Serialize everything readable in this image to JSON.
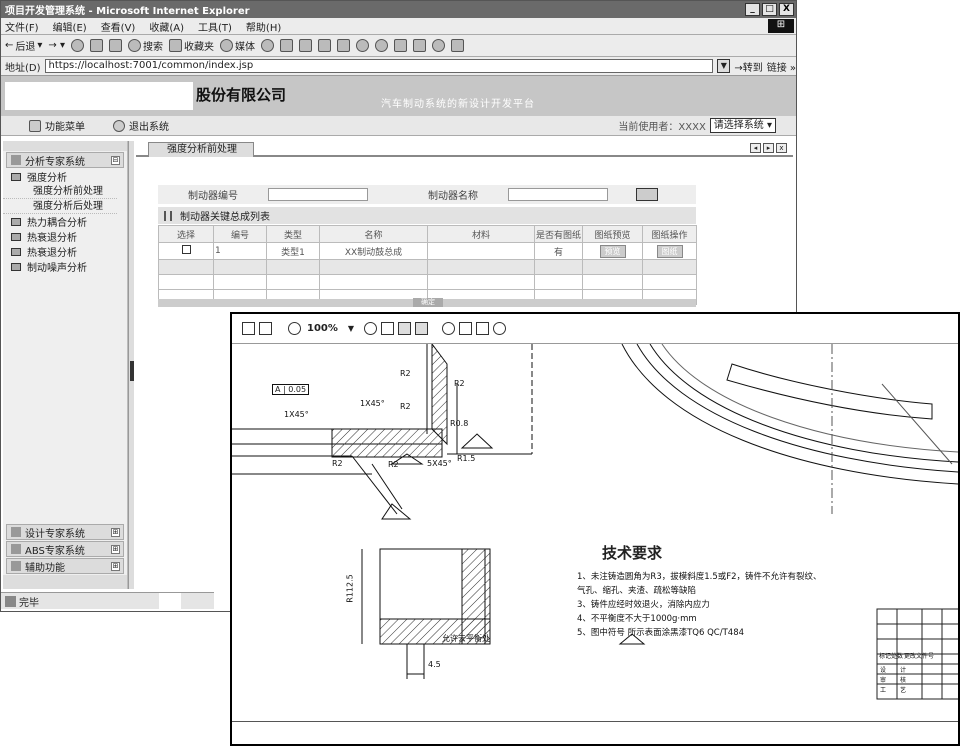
{
  "window": {
    "title": "项目开发管理系统 - Microsoft Internet Explorer",
    "min": "_",
    "max": "□",
    "close": "X"
  },
  "menu": [
    "文件(F)",
    "编辑(E)",
    "查看(V)",
    "收藏(A)",
    "工具(T)",
    "帮助(H)"
  ],
  "toolbar": {
    "back": "后退",
    "search": "搜索",
    "favorites": "收藏夹",
    "media": "媒体"
  },
  "address": {
    "label": "地址(D)",
    "url": "https://localhost:7001/common/index.jsp",
    "go": "转到",
    "links": "链接 »"
  },
  "banner": {
    "company": "股份有限公司",
    "platform": "汽车制动系统的新设计开发平台"
  },
  "nav": {
    "function_menu": "功能菜单",
    "logout": "退出系统",
    "current_user": "当前使用者：XXXX",
    "system_select": "请选择系统"
  },
  "sidebar": {
    "top_section": "分析专家系统",
    "items": [
      {
        "label": "强度分析"
      },
      {
        "label": "强度分析前处理",
        "sub": true
      },
      {
        "label": "强度分析后处理",
        "sub": true
      },
      {
        "label": "热力耦合分析"
      },
      {
        "label": "热衰退分析"
      },
      {
        "label": "热衰退分析"
      },
      {
        "label": "制动噪声分析"
      }
    ],
    "bottom_sections": [
      "设计专家系统",
      "ABS专家系统",
      "辅助功能"
    ]
  },
  "content": {
    "tab": "强度分析前处理",
    "form": {
      "code_label": "制动器编号",
      "name_label": "制动器名称"
    },
    "table_title": "制动器关键总成列表",
    "columns": [
      "选择",
      "编号",
      "类型",
      "名称",
      "材料",
      "是否有图纸",
      "图纸预览",
      "图纸操作"
    ],
    "rows": [
      {
        "id": "1",
        "type": "类型1",
        "name": "XX制动鼓总成",
        "material": "",
        "has_drawing": "有",
        "preview": "预览",
        "action": "图纸"
      }
    ],
    "confirm": "确定"
  },
  "status": {
    "text": "完毕"
  },
  "viewer": {
    "zoom": "100%",
    "tech_title": "技术要求",
    "requirements": [
      "1、未注铸造圆角为R3，拔模斜度1.5或F2，铸件不允许有裂纹、",
      "   气孔、缩孔、夹渣、疏松等缺陷",
      "3、铸件应经时效退火，消除内应力",
      "4、不平衡度不大于1000g·mm",
      "5、图中符号    所示表面涂黑漆TQ6 QC/T484"
    ],
    "labels": {
      "r2a": "R2",
      "r2b": "R2",
      "r2c": "R2",
      "r2d": "R2",
      "r2e": "R2",
      "tol": "0.05",
      "tol_a": "A",
      "note": "允许去平衡处",
      "dim45": "4.5",
      "r15": "R1.5",
      "dim_r1125": "R112.5",
      "ch1": "1X45°",
      "ch2": "1X45°",
      "ch3": "5X45°",
      "r08": "R0.8"
    },
    "titleblock": [
      "标记处数",
      "更改文件号",
      "设",
      "计",
      "审",
      "核",
      "工",
      "艺"
    ]
  }
}
